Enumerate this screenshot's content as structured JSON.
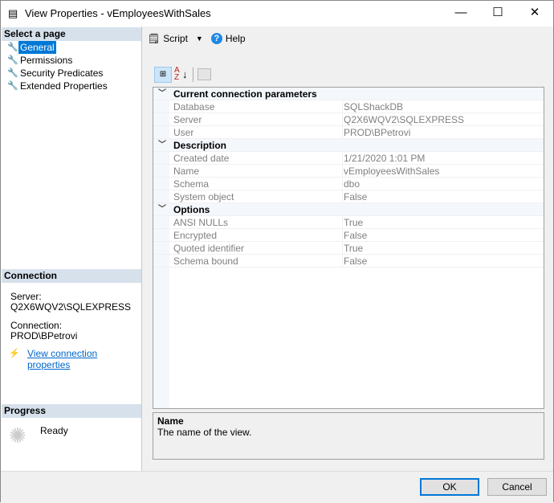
{
  "window": {
    "title": "View Properties - vEmployeesWithSales",
    "minimize": "—",
    "maximize": "☐",
    "close": "✕"
  },
  "sidebar": {
    "select_header": "Select a page",
    "items": [
      {
        "label": "General"
      },
      {
        "label": "Permissions"
      },
      {
        "label": "Security Predicates"
      },
      {
        "label": "Extended Properties"
      }
    ],
    "connection_header": "Connection",
    "server_label": "Server:",
    "server_value": "Q2X6WQV2\\SQLEXPRESS",
    "connection_label": "Connection:",
    "connection_value": "PROD\\BPetrovi",
    "view_conn_link": "View connection properties",
    "progress_header": "Progress",
    "progress_status": "Ready"
  },
  "toolbar": {
    "script_label": "Script",
    "help_label": "Help"
  },
  "grid": {
    "categories": [
      {
        "name": "Current connection parameters",
        "rows": [
          {
            "k": "Database",
            "v": "SQLShackDB"
          },
          {
            "k": "Server",
            "v": "Q2X6WQV2\\SQLEXPRESS"
          },
          {
            "k": "User",
            "v": "PROD\\BPetrovi"
          }
        ]
      },
      {
        "name": "Description",
        "rows": [
          {
            "k": "Created date",
            "v": "1/21/2020 1:01 PM"
          },
          {
            "k": "Name",
            "v": "vEmployeesWithSales"
          },
          {
            "k": "Schema",
            "v": "dbo"
          },
          {
            "k": "System object",
            "v": "False"
          }
        ]
      },
      {
        "name": "Options",
        "rows": [
          {
            "k": "ANSI NULLs",
            "v": "True"
          },
          {
            "k": "Encrypted",
            "v": "False"
          },
          {
            "k": "Quoted identifier",
            "v": "True"
          },
          {
            "k": "Schema bound",
            "v": "False"
          }
        ]
      }
    ]
  },
  "description": {
    "title": "Name",
    "text": "The name of the view."
  },
  "buttons": {
    "ok": "OK",
    "cancel": "Cancel"
  }
}
